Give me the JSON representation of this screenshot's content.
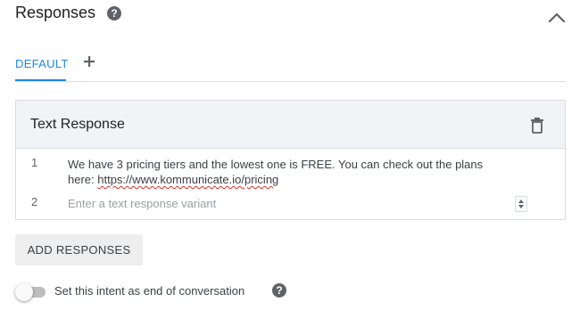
{
  "header": {
    "title": "Responses",
    "help_icon": "help-circle-icon",
    "collapse_icon": "chevron-up-icon"
  },
  "tabs": {
    "items": [
      {
        "label": "DEFAULT",
        "active": true
      }
    ],
    "add_icon": "plus-icon"
  },
  "card": {
    "title": "Text Response",
    "delete_icon": "trash-icon",
    "rows": [
      {
        "number": "1",
        "text_line1": "We have 3 pricing tiers and the lowest one is FREE. You can check out the plans",
        "text_line2_prefix": "here: ",
        "text_link": "https://www.kommunicate.io/pricing"
      },
      {
        "number": "2",
        "placeholder": "Enter a text response variant",
        "value": ""
      }
    ]
  },
  "actions": {
    "add_responses_label": "ADD RESPONSES"
  },
  "end_conversation": {
    "label": "Set this intent as end of conversation",
    "enabled": false,
    "help_icon": "help-circle-icon"
  },
  "colors": {
    "accent": "#1e88e5",
    "help_icon_bg": "#5f6368",
    "card_header_bg": "#f1f3f4",
    "button_bg": "#eeeeee",
    "toggle_track": "#bdbdbd"
  }
}
